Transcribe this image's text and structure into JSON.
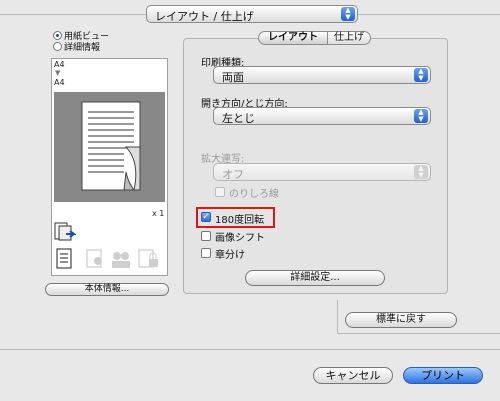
{
  "top_popup": {
    "value": "レイアウト / 仕上げ"
  },
  "preview": {
    "radio_paper_view": "用紙ビュー",
    "radio_detail_view": "詳細情報",
    "size_top": "A4",
    "size_bottom": "A4",
    "copies": "x 1",
    "machine_info_button": "本体情報..."
  },
  "tabs": {
    "layout": "レイアウト",
    "finishing": "仕上げ"
  },
  "print_type": {
    "label": "印刷種類:",
    "value": "両面"
  },
  "binding": {
    "label": "開き方向/とじ方向:",
    "value": "左とじ"
  },
  "enlarge": {
    "label": "拡大連写:",
    "value": "オフ",
    "margin_label": "のりしろ線"
  },
  "options": {
    "rotate180": {
      "label": "180度回転",
      "checked": true
    },
    "image_shift": {
      "label": "画像シフト",
      "checked": false
    },
    "chapter": {
      "label": "章分け",
      "checked": false
    }
  },
  "detail_button": "詳細設定...",
  "reset_button": "標準に戻す",
  "cancel_button": "キャンセル",
  "print_button": "プリント",
  "colors": {
    "accent": "#2f73e0",
    "highlight": "#e01515"
  }
}
